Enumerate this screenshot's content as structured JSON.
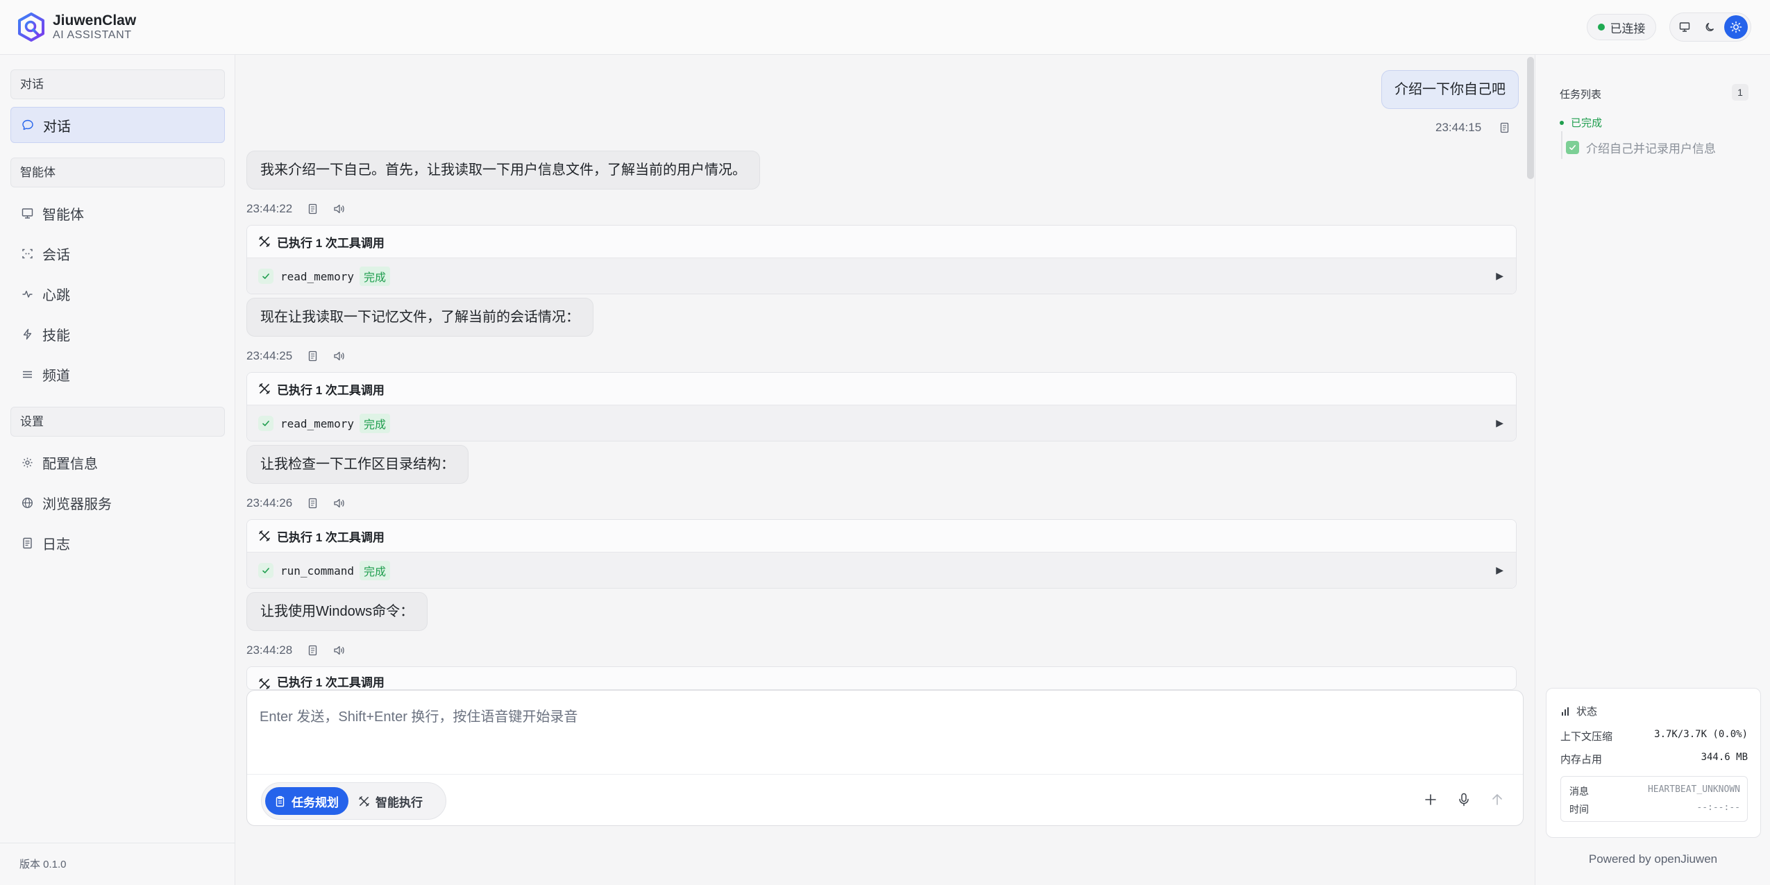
{
  "header": {
    "app_name": "JiuwenClaw",
    "app_sub": "AI ASSISTANT",
    "connection_status": "已连接",
    "colors": {
      "accent": "#2563eb",
      "connected": "#1faa52"
    }
  },
  "sidebar": {
    "sections": [
      {
        "title": "对话",
        "items": [
          {
            "label": "对话",
            "icon": "chat-bubble-icon",
            "active": true
          }
        ]
      },
      {
        "title": "智能体",
        "items": [
          {
            "label": "智能体",
            "icon": "monitor-icon"
          },
          {
            "label": "会话",
            "icon": "session-icon"
          },
          {
            "label": "心跳",
            "icon": "heartbeat-icon"
          },
          {
            "label": "技能",
            "icon": "lightning-icon"
          },
          {
            "label": "频道",
            "icon": "list-icon"
          }
        ]
      },
      {
        "title": "设置",
        "items": [
          {
            "label": "配置信息",
            "icon": "gear-icon"
          },
          {
            "label": "浏览器服务",
            "icon": "globe-icon"
          },
          {
            "label": "日志",
            "icon": "document-icon"
          }
        ]
      }
    ],
    "version": "版本 0.1.0"
  },
  "chat": {
    "user_message": {
      "text": "介绍一下你自己吧",
      "time": "23:44:15"
    },
    "bot_messages": [
      {
        "text": "我来介绍一下自己。首先，让我读取一下用户信息文件，了解当前的用户情况。",
        "time": "23:44:22"
      },
      {
        "text": "现在让我读取一下记忆文件，了解当前的会话情况：",
        "time": "23:44:25"
      },
      {
        "text": "让我检查一下工作区目录结构：",
        "time": "23:44:26"
      },
      {
        "text": "让我使用Windows命令：",
        "time": "23:44:28"
      }
    ],
    "tool_calls": [
      {
        "title": "已执行 1 次工具调用",
        "tool": "read_memory",
        "status": "完成"
      },
      {
        "title": "已执行 1 次工具调用",
        "tool": "read_memory",
        "status": "完成"
      },
      {
        "title": "已执行 1 次工具调用",
        "tool": "run_command",
        "status": "完成"
      },
      {
        "title": "已执行 1 次工具调用"
      }
    ]
  },
  "composer": {
    "placeholder": "Enter 发送，Shift+Enter 换行，按住语音键开始录音",
    "modes": [
      {
        "label": "任务规划",
        "active": true
      },
      {
        "label": "智能执行"
      }
    ]
  },
  "right_panel": {
    "title": "任务列表",
    "count": "1",
    "status": "已完成",
    "task": "介绍自己并记录用户信息",
    "status_card": {
      "title": "状态",
      "context_label": "上下文压缩",
      "context_value": "3.7K/3.7K (0.0%)",
      "memory_label": "内存占用",
      "memory_value": "344.6 MB",
      "message_label": "消息",
      "message_value": "HEARTBEAT_UNKNOWN",
      "time_label": "时间",
      "time_value": "--:--:--"
    },
    "powered_by": "Powered by openJiuwen"
  }
}
